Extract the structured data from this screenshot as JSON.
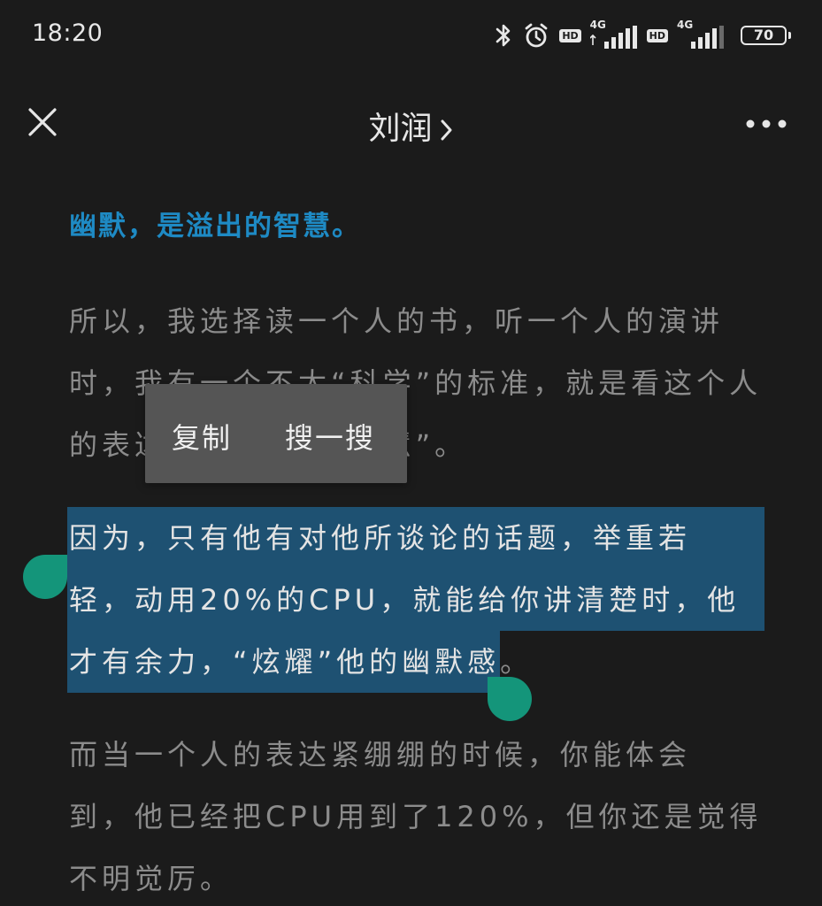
{
  "status_bar": {
    "time": "18:20",
    "network_1": "4G",
    "network_2": "4G",
    "hd_1": "HD",
    "hd_2": "HD",
    "battery": "70",
    "icons": [
      "bluetooth-icon",
      "alarm-icon",
      "hd-icon",
      "signal-icon",
      "hd-icon",
      "signal-icon",
      "battery-icon"
    ]
  },
  "header": {
    "title": "刘润",
    "close_icon": "close-icon",
    "more_icon": "more-icon",
    "chevron_icon": "chevron-right-icon"
  },
  "article": {
    "heading": "幽默，是溢出的智慧。",
    "p1": [
      "所以，我选择读一个人的书，听一个人的演讲",
      "时，我有一个不太“科学”的标准，就是看这个人",
      "的表达能不能“溢出智慧”。"
    ],
    "p2": [
      "因为，只有他有对他所谈论的话题，举重若",
      "轻，动用20%的CPU，就能给你讲清楚时，他",
      "才有余力，“炫耀”他的幽默感"
    ],
    "p2_tail": "。",
    "p3": [
      "而当一个人的表达紧绷绷的时候，你能体会",
      "到，他已经把CPU用到了120%，但你还是觉得",
      "不明觉厉。"
    ]
  },
  "context_menu": {
    "copy": "复制",
    "search": "搜一搜"
  },
  "colors": {
    "background": "#1b1b1b",
    "heading": "#1e8ac4",
    "text": "#8c8c8c",
    "selection": "#1e5172",
    "handle": "#14957a",
    "menu": "#555555"
  }
}
